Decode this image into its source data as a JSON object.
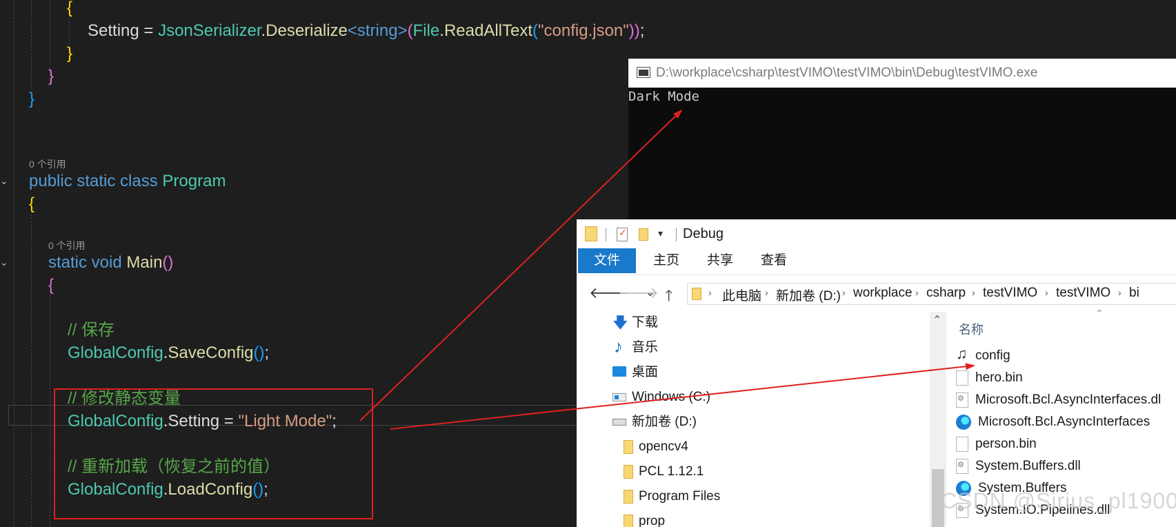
{
  "editor": {
    "code": {
      "setting_line": {
        "lhs": "Setting",
        "eq": " = ",
        "cls": "JsonSerializer",
        "dot1": ".",
        "method": "Deserialize",
        "gen_open": "<",
        "type": "string",
        "gen_close": ">",
        "paren_open": "(",
        "file_cls": "File",
        "dot2": ".",
        "read_method": "ReadAllText",
        "paren2_open": "(",
        "path_str": "\"config.json\"",
        "close_parens": "))",
        "semi": ";"
      },
      "brace_open": "{",
      "brace_close": "}",
      "refs_class": "0 个引用",
      "refs_main": "0 个引用",
      "class_decl": {
        "kw": "public static class ",
        "name": "Program"
      },
      "main_decl": {
        "kw": "static void ",
        "name": "Main",
        "parens": "()"
      },
      "comment_save": "// 保存",
      "save_call": {
        "cls": "GlobalConfig",
        "dot": ".",
        "method": "SaveConfig",
        "parens": "()",
        "semi": ";"
      },
      "comment_modify": "// 修改静态变量",
      "assign": {
        "cls": "GlobalConfig",
        "dot": ".",
        "prop": "Setting",
        "eq": " = ",
        "value": "\"Light Mode\"",
        "semi": ";"
      },
      "comment_reload": "// 重新加载（恢复之前的值）",
      "load_call": {
        "cls": "GlobalConfig",
        "dot": ".",
        "method": "LoadConfig",
        "parens": "()",
        "semi": ";"
      }
    },
    "colors": {
      "keyword": "#569cd6",
      "class": "#4ec9b0",
      "method": "#dcdcaa",
      "string": "#d69d85",
      "comment": "#57a64a",
      "annotation": "#e02020"
    }
  },
  "console": {
    "title": "D:\\workplace\\csharp\\testVIMO\\testVIMO\\bin\\Debug\\testVIMO.exe",
    "output": "Dark Mode",
    "icon": "console-window-icon"
  },
  "explorer": {
    "window_title": "Debug",
    "quick_access_dropdown": "▾",
    "ribbon_tabs": [
      "文件",
      "主页",
      "共享",
      "查看"
    ],
    "nav_buttons": {
      "back": "🡐",
      "forward": "🡒",
      "recent": "⌄",
      "up": "🡑"
    },
    "breadcrumb": [
      "此电脑",
      "新加卷 (D:)",
      "workplace",
      "csharp",
      "testVIMO",
      "testVIMO",
      "bi"
    ],
    "nav_items": [
      {
        "label": "下载",
        "icon": "download-icon"
      },
      {
        "label": "音乐",
        "icon": "music-icon"
      },
      {
        "label": "桌面",
        "icon": "desktop-icon"
      },
      {
        "label": "Windows (C:)",
        "icon": "windows-drive-icon"
      },
      {
        "label": "新加卷 (D:)",
        "icon": "drive-icon"
      },
      {
        "label": "opencv4",
        "icon": "folder-icon"
      },
      {
        "label": "PCL 1.12.1",
        "icon": "folder-icon"
      },
      {
        "label": "Program Files",
        "icon": "folder-icon"
      },
      {
        "label": "prop",
        "icon": "folder-icon"
      }
    ],
    "column_header": "名称",
    "files": [
      {
        "name": "config",
        "icon": "config-file-icon"
      },
      {
        "name": "hero.bin",
        "icon": "file-icon"
      },
      {
        "name": "Microsoft.Bcl.AsyncInterfaces.dl",
        "icon": "dll-icon"
      },
      {
        "name": "Microsoft.Bcl.AsyncInterfaces",
        "icon": "edge-icon"
      },
      {
        "name": "person.bin",
        "icon": "file-icon"
      },
      {
        "name": "System.Buffers.dll",
        "icon": "dll-icon"
      },
      {
        "name": "System.Buffers",
        "icon": "edge-icon"
      },
      {
        "name": "System.IO.Pipelines.dll",
        "icon": "dll-icon"
      }
    ]
  },
  "watermark": "CSDN @Sirius_pl1900"
}
